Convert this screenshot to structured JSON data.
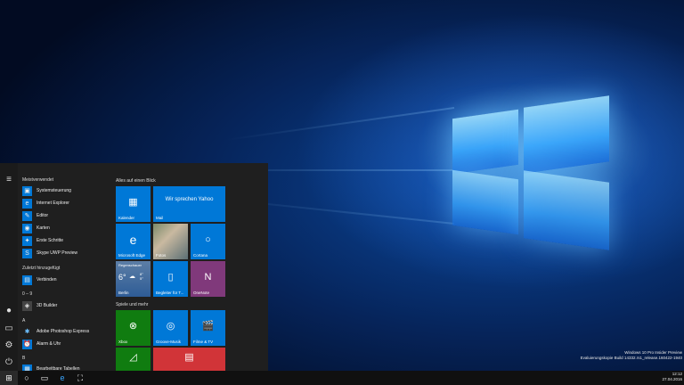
{
  "colors": {
    "accent": "#0078d7",
    "xbox": "#107c10",
    "onenote": "#80397b",
    "red": "#d13438"
  },
  "start_menu": {
    "most_used_title": "Meistverwendet",
    "most_used": [
      {
        "label": "Systemsteuerung",
        "icon": "control-panel-icon"
      },
      {
        "label": "Internet Explorer",
        "icon": "internet-explorer-icon"
      },
      {
        "label": "Editor",
        "icon": "notepad-icon"
      },
      {
        "label": "Karten",
        "icon": "maps-icon"
      },
      {
        "label": "Erste Schritte",
        "icon": "get-started-icon"
      },
      {
        "label": "Skype UWP Preview",
        "icon": "skype-icon"
      }
    ],
    "recent_title": "Zuletzt hinzugefügt",
    "recent": [
      {
        "label": "Verbinden",
        "icon": "connect-icon"
      }
    ],
    "groups": [
      {
        "letter": "0 – 9",
        "items": [
          {
            "label": "3D Builder",
            "icon": "3d-builder-icon"
          }
        ]
      },
      {
        "letter": "A",
        "items": [
          {
            "label": "Adobe Photoshop Express",
            "icon": "photoshop-icon"
          },
          {
            "label": "Alarm & Uhr",
            "icon": "alarm-icon"
          }
        ]
      },
      {
        "letter": "B",
        "items": [
          {
            "label": "Bearbeitbare Tabellen",
            "icon": "table-icon"
          }
        ]
      }
    ],
    "tiles_group1_title": "Alles auf einen Blick",
    "tiles_group2_title": "Spiele und mehr",
    "tiles": {
      "calendar": "Kalender",
      "mail_text": "Wir sprechen Yahoo",
      "mail": "Mail",
      "edge": "Microsoft Edge",
      "photos": "Fotos",
      "cortana": "Cortana",
      "weather_cond": "Regenschauer",
      "weather_temp": "6°",
      "weather_hi": "8°",
      "weather_lo": "5°",
      "weather_city": "Berlin",
      "phone": "Begleiter für T...",
      "onenote": "OneNote",
      "xbox": "Xbox",
      "groove": "Groove-Musik",
      "movies": "Filme & TV"
    }
  },
  "watermark": {
    "line1": "Windows 10 Pro Insider Preview",
    "line2": "Evaluierungskopie Build 14332.rs1_release.160422-1940"
  },
  "taskbar": {
    "time": "12:12",
    "date": "27.04.2016"
  }
}
